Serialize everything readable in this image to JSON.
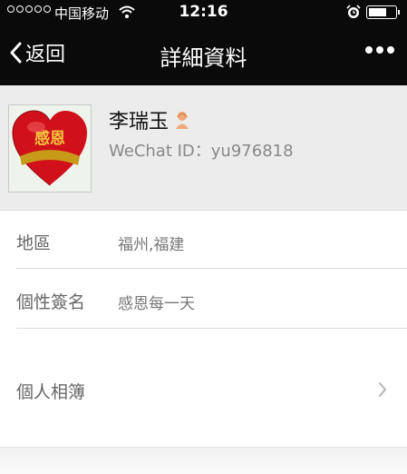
{
  "status_bar": {
    "carrier": "中国移动",
    "time": "12:16"
  },
  "nav": {
    "back_label": "返回",
    "title": "詳細資料"
  },
  "profile": {
    "name": "李瑞玉",
    "wechat_id": "WeChat ID：yu976818",
    "avatar_text": "感恩",
    "gender_icon": "female-icon"
  },
  "rows": [
    {
      "key": "地區",
      "value": "福州,福建"
    },
    {
      "key": "個性簽名",
      "value": "感恩每一天"
    },
    {
      "key": "個人相簿",
      "value": ""
    }
  ],
  "colors": {
    "topbar": "#0a0a0a",
    "profile_bg": "#ececec",
    "heart": "#d0101a"
  }
}
